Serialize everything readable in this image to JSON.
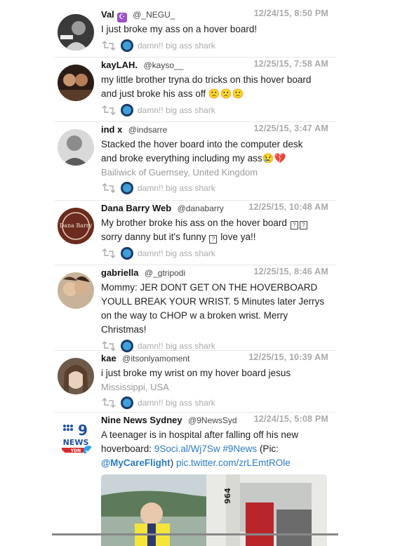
{
  "retweet_label": "damn!! big ass shark",
  "tweets": [
    {
      "name": "Val",
      "badge": "☪",
      "handle": "@_NEGU_",
      "date": "12/24/15, 8:50 PM",
      "text": "I just broke my ass on a hover board!"
    },
    {
      "name": "kayLAH.",
      "handle": "@kayso__",
      "date": "12/25/15, 7:58 AM",
      "text_line1": "my little brother tryna do tricks on this hover board",
      "text_line2": "and just broke his ass off",
      "emoji": "🙁🙁🙁"
    },
    {
      "name": "ind x",
      "handle": "@indsarre",
      "date": "12/25/15, 3:47 AM",
      "text_line1": "Stacked the hover board into the computer desk",
      "text_line2": "and broke everything including my ass",
      "emoji": "😢💔",
      "location": "Bailiwick of Guernsey, United Kingdom"
    },
    {
      "name": "Dana Barry Web",
      "handle": "@danabarry",
      "date": "12/25/15, 10:48 AM",
      "text_line1": "My brother broke his ass on the hover board",
      "text_line2a": "sorry danny but it's funny",
      "text_line2b": "love ya!!",
      "tofu": "?"
    },
    {
      "name": "gabriella",
      "handle": "@_gtripodi",
      "date": "12/25/15, 8:46 AM",
      "lines": [
        "Mommy: JER DONT GET ON THE HOVERBOARD",
        "YOULL BREAK YOUR WRIST. 5 Minutes later Jerrys",
        "on the way to CHOP w a broken wrist. Merry",
        "Christmas!"
      ]
    },
    {
      "name": "kae",
      "handle": "@itsonlyamoment",
      "date": "12/25/15, 10:39 AM",
      "text": "i just broke my wrist on my hover board jesus",
      "location": "Mississippi, USA"
    },
    {
      "name": "Nine News Sydney",
      "handle": "@9NewsSyd",
      "date": "12/24/15, 5:08 PM",
      "text_line1": "A teenager is in hospital after falling off his new",
      "text_line2_prefix": "hoverboard:",
      "link1": "9Soci.al/Wj7Sw",
      "hashtag": "#9News",
      "pic_prefix": "(Pic:",
      "mention": "@MyCareFlight",
      "pic_suffix": ")",
      "link2": "pic.twitter.com/zrLEmtROle",
      "logo_top": "9",
      "logo_mid": "NEWS",
      "logo_bottom": "YDN",
      "media_text": "964"
    }
  ]
}
